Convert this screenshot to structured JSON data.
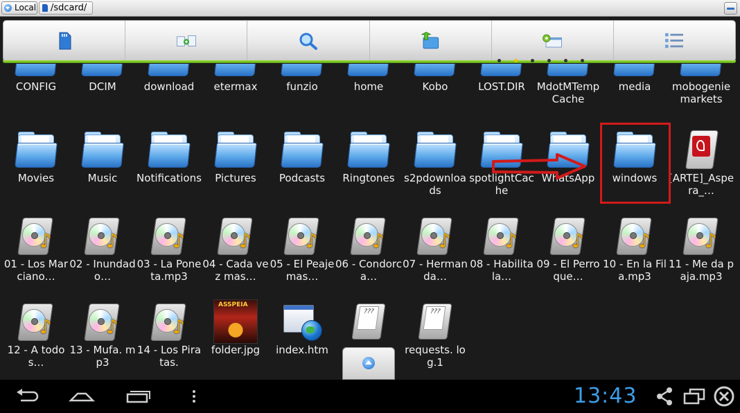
{
  "pathbar": {
    "location_label": "Local",
    "path": "/sdcard/"
  },
  "toolbar": {
    "buttons": [
      {
        "name": "sdcard-icon"
      },
      {
        "name": "copy-to-icon"
      },
      {
        "name": "search-icon"
      },
      {
        "name": "folder-up-icon"
      },
      {
        "name": "settings-window-icon"
      },
      {
        "name": "list-view-icon"
      }
    ],
    "page_dots": 6,
    "active_dot": 1
  },
  "files": [
    {
      "label": "CONFIG",
      "type": "folder"
    },
    {
      "label": "DCIM",
      "type": "folder"
    },
    {
      "label": "download",
      "type": "folder"
    },
    {
      "label": "etermax",
      "type": "folder"
    },
    {
      "label": "funzio",
      "type": "folder"
    },
    {
      "label": "home",
      "type": "folder"
    },
    {
      "label": "Kobo",
      "type": "folder"
    },
    {
      "label": "LOST.DIR",
      "type": "folder"
    },
    {
      "label": "MdotMTempCache",
      "type": "folder"
    },
    {
      "label": "media",
      "type": "folder"
    },
    {
      "label": "mobogenie markets",
      "type": "folder"
    },
    {
      "label": "Movies",
      "type": "folder"
    },
    {
      "label": "Music",
      "type": "folder"
    },
    {
      "label": "Notifications",
      "type": "folder"
    },
    {
      "label": "Pictures",
      "type": "folder"
    },
    {
      "label": "Podcasts",
      "type": "folder"
    },
    {
      "label": "Ringtones",
      "type": "folder"
    },
    {
      "label": "s2pdownloads",
      "type": "folder"
    },
    {
      "label": "spotlightCache",
      "type": "folder"
    },
    {
      "label": "WhatsApp",
      "type": "folder"
    },
    {
      "label": "windows",
      "type": "folder"
    },
    {
      "label": "[ARTE]_Aspera_…",
      "type": "pdf"
    },
    {
      "label": "01 - Los Marciano…",
      "type": "audio"
    },
    {
      "label": "02 - Inundado…",
      "type": "audio"
    },
    {
      "label": "03 - La Poneta.mp3",
      "type": "audio"
    },
    {
      "label": "04 - Cada vez mas…",
      "type": "audio"
    },
    {
      "label": "05 - El Peaje mas…",
      "type": "audio"
    },
    {
      "label": "06 - Condorca…",
      "type": "audio"
    },
    {
      "label": "07 - Hermanda…",
      "type": "audio"
    },
    {
      "label": "08 - Habilita la…",
      "type": "audio"
    },
    {
      "label": "09 - El Perro que…",
      "type": "audio"
    },
    {
      "label": "10 - En la Fila.mp3",
      "type": "audio"
    },
    {
      "label": "11 - Me da paja.mp3",
      "type": "audio"
    },
    {
      "label": "12 - A todos…",
      "type": "audio"
    },
    {
      "label": "13 - Mufa. mp3",
      "type": "audio"
    },
    {
      "label": "14 - Los Piratas.",
      "type": "audio"
    },
    {
      "label": "folder.jpg",
      "type": "image"
    },
    {
      "label": "index.htm",
      "type": "html"
    },
    {
      "label": "",
      "type": "text"
    },
    {
      "label": "requests. log.1",
      "type": "text"
    }
  ],
  "text_icon_mark": "???",
  "clock": "13:43",
  "colors": {
    "accent_green": "#7cc52a",
    "clock_blue": "#3e9ee8",
    "annotation_red": "#d21a1a"
  }
}
